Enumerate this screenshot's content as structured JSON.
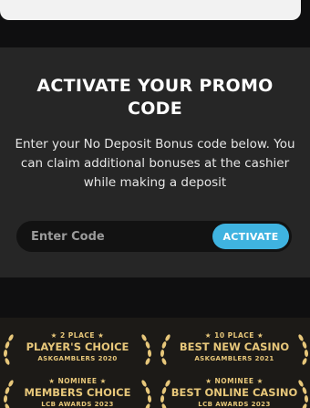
{
  "promo": {
    "title": "ACTIVATE YOUR PROMO CODE",
    "description": "Enter your No Deposit Bonus code below. You can claim additional bonuses at the cashier while making a deposit",
    "input_placeholder": "Enter Code",
    "input_value": "",
    "activate_label": "ACTIVATE",
    "accent_color": "#3fb3e0"
  },
  "awards": [
    {
      "rank": "★ 2 PLACE ★",
      "name": "PLAYER'S CHOICE",
      "org": "ASKGAMBLERS 2020"
    },
    {
      "rank": "★ 10 PLACE ★",
      "name": "BEST NEW CASINO",
      "org": "ASKGAMBLERS 2021"
    },
    {
      "rank": "★ NOMINEE ★",
      "name": "MEMBERS CHOICE",
      "org": "LCB AWARDS 2023"
    },
    {
      "rank": "★ NOMINEE ★",
      "name": "BEST ONLINE CASINO",
      "org": "LCB AWARDS 2023"
    }
  ],
  "colors": {
    "award_gold": "#e7c77a",
    "panel_bg": "#262626",
    "page_bg": "#0f0f10"
  }
}
